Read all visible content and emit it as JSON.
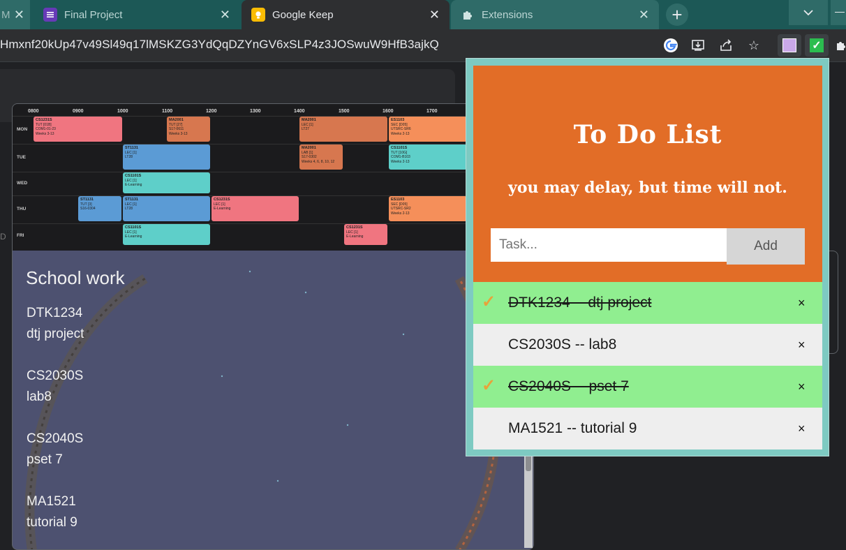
{
  "browser": {
    "tabs": [
      {
        "title": "M",
        "icon": "partial-tab-icon"
      },
      {
        "title": "Final Project",
        "icon": "forms-list-icon"
      },
      {
        "title": "Google Keep",
        "icon": "keep-bulb-icon",
        "active": true
      },
      {
        "title": "Extensions",
        "icon": "puzzle-icon"
      }
    ],
    "new_tab_label": "+",
    "url": "Hmxnf20kUp47v49Sl49q17lMSKZG3YdQqDZYnGV6xSLP4z3JOSwuW9HfB3ajkQ"
  },
  "timetable": {
    "hours": [
      "0800",
      "0900",
      "1000",
      "1100",
      "1200",
      "1300",
      "1400",
      "1500",
      "1600",
      "1700"
    ],
    "days": [
      "MON",
      "TUE",
      "WED",
      "THU",
      "FRI"
    ],
    "sessions": [
      {
        "day": "MON",
        "lines": [
          "CS1231S",
          "TUT [01B]",
          "COM1-01-23",
          "Weeks 3-13"
        ],
        "color": "#f07580"
      },
      {
        "day": "MON",
        "lines": [
          "MA2001",
          "TUT [27]",
          "S17-0611",
          "Weeks 3-13"
        ],
        "color": "#d7774f"
      },
      {
        "day": "MON",
        "lines": [
          "MA2001",
          "LEC [1]",
          "LT27"
        ],
        "color": "#d7774f"
      },
      {
        "day": "MON",
        "lines": [
          "ES1103",
          "SEC [D05]",
          "UTSRC-SR6",
          "Weeks 2-13"
        ],
        "color": "#f58f5a"
      },
      {
        "day": "TUE",
        "lines": [
          "ST1131",
          "LEC [1]",
          "LT28"
        ],
        "color": "#5b9bd5"
      },
      {
        "day": "TUE",
        "lines": [
          "MA2001",
          "LAB [1]",
          "S17-0302",
          "Weeks 4, 6, 8, 10, 12"
        ],
        "color": "#d7774f"
      },
      {
        "day": "TUE",
        "lines": [
          "CS1101S",
          "TUT [10G]",
          "COM1-B103",
          "Weeks 2-13"
        ],
        "color": "#5ecfc9"
      },
      {
        "day": "WED",
        "lines": [
          "CS1101S",
          "LEC [1]",
          "E-Learning"
        ],
        "color": "#5ecfc9"
      },
      {
        "day": "THU",
        "lines": [
          "ST1131",
          "TUT [3]",
          "S16-0304"
        ],
        "color": "#5b9bd5"
      },
      {
        "day": "THU",
        "lines": [
          "ST1131",
          "LEC [1]",
          "LT28"
        ],
        "color": "#5b9bd5"
      },
      {
        "day": "THU",
        "lines": [
          "CS1231S",
          "LEC [1]",
          "E-Learning"
        ],
        "color": "#f07580"
      },
      {
        "day": "THU",
        "lines": [
          "ES1103",
          "SEC [D05]",
          "UTSRC-SR2",
          "Weeks 2-13"
        ],
        "color": "#f58f5a"
      },
      {
        "day": "FRI",
        "lines": [
          "CS1101S",
          "LEC [1]",
          "E-Learning"
        ],
        "color": "#5ecfc9"
      },
      {
        "day": "FRI",
        "lines": [
          "CS1231S",
          "LEC [1]",
          "E-Learning"
        ],
        "color": "#f07580"
      }
    ]
  },
  "note": {
    "title": "School work",
    "lines": [
      "DTK1234",
      "dtj project",
      "CS2030S",
      "lab8",
      "CS2040S",
      "pset 7",
      "MA1521",
      "tutorial 9"
    ]
  },
  "popup": {
    "title": "To Do List",
    "subtitle": "you may delay, but time will not.",
    "input_placeholder": "Task...",
    "add_label": "Add",
    "todos": [
      {
        "text": "DTK1234 -- dtj project",
        "checked": true
      },
      {
        "text": "CS2030S -- lab8",
        "checked": false
      },
      {
        "text": "CS2040S -- pset 7",
        "checked": true
      },
      {
        "text": "MA1521 -- tutorial 9",
        "checked": false
      }
    ],
    "check_glyph": "✓",
    "remove_glyph": "×"
  },
  "colors": {
    "accent_orange": "#e26d27",
    "popup_border": "#7ecac2",
    "checked_green": "#90ee90",
    "tabstrip_teal": "#1c5856"
  }
}
